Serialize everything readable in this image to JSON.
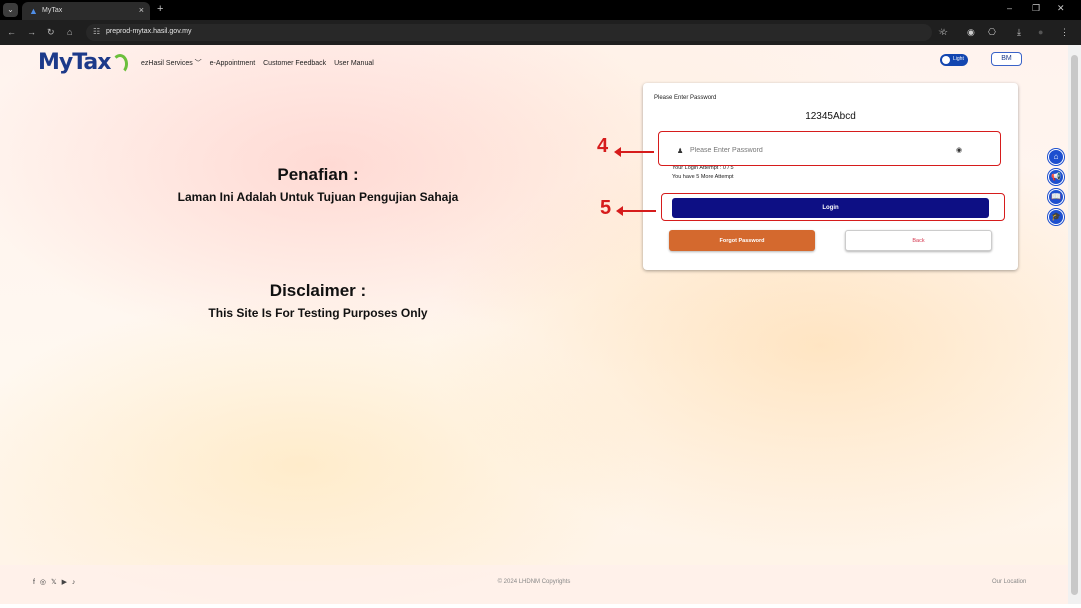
{
  "browser": {
    "tab_title": "MyTax",
    "url": "preprod-mytax.hasil.gov.my",
    "new_tab": "+",
    "menu_icon": "chevron-down-icon",
    "tab_close": "×",
    "win_min": "–",
    "win_restore": "❐",
    "win_close": "✕",
    "nav_back": "←",
    "nav_forward": "→",
    "nav_reload": "↻",
    "nav_home": "⌂",
    "site_info": "☷",
    "bookmark": "☆",
    "extension": "◉",
    "sidepanel": "⎔",
    "download": "⤓",
    "profile": "●",
    "more": "⋮"
  },
  "header": {
    "logo_my": "My",
    "logo_tax": "Tax",
    "nav_items": [
      "ezHasil Services ﹀",
      "e-Appointment",
      "Customer Feedback",
      "User Manual"
    ],
    "theme_label": "Light",
    "lang_button": "BM"
  },
  "disclaimer": {
    "ms_title": "Penafian :",
    "ms_text": "Laman Ini Adalah Untuk Tujuan Pengujian Sahaja",
    "en_title": "Disclaimer :",
    "en_text": "This Site Is For Testing Purposes Only"
  },
  "login": {
    "label": "Please Enter Password",
    "user_id": "12345Abcd",
    "password_placeholder": "Please Enter Password",
    "password_value": "",
    "attempt_line1": "Your Login Attempt : 0 / 5",
    "attempt_line2": "You have 5 More Attempt",
    "login_button": "Login",
    "forgot_button": "Forgot Password",
    "back_button": "Back"
  },
  "annotations": {
    "step_password": "4",
    "step_login": "5",
    "color": "#d61c1c"
  },
  "side_buttons": [
    "⌂",
    "📢",
    "📖",
    "🎓"
  ],
  "footer": {
    "social": [
      "f",
      "◎",
      "𝕏",
      "▶",
      "♪"
    ],
    "copyright": "© 2024 LHDNM Copyrights",
    "our_location": "Our Location"
  },
  "colors": {
    "brand_blue": "#1d3a8a",
    "login_button": "#0d0f84",
    "forgot_button": "#d4692e",
    "back_text": "#d4364e"
  }
}
